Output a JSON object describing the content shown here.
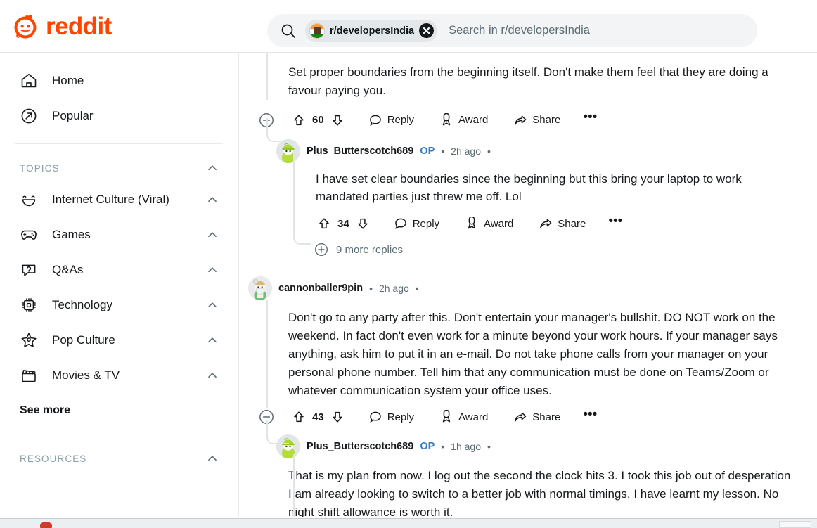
{
  "header": {
    "logo_text": "reddit",
    "logo_icon": "reddit-snoo-icon",
    "brand_color": "#ff4500",
    "search": {
      "icon": "search-icon",
      "chip_label": "r/developersIndia",
      "chip_avatar_icon": "subreddit-avatar-icon",
      "chip_close_icon": "close-icon",
      "placeholder": "Search in r/developersIndia"
    }
  },
  "sidebar": {
    "nav": [
      {
        "label": "Home",
        "icon": "home-icon"
      },
      {
        "label": "Popular",
        "icon": "popular-arrow-icon"
      }
    ],
    "topics_section": {
      "title": "TOPICS",
      "chevron": "chevron-up-icon"
    },
    "topics": [
      {
        "label": "Internet Culture (Viral)",
        "icon": "smiley-face-icon",
        "chevron": "chevron-up-icon"
      },
      {
        "label": "Games",
        "icon": "gamepad-icon",
        "chevron": "chevron-up-icon"
      },
      {
        "label": "Q&As",
        "icon": "question-bubble-icon",
        "chevron": "chevron-up-icon"
      },
      {
        "label": "Technology",
        "icon": "cpu-chip-icon",
        "chevron": "chevron-up-icon"
      },
      {
        "label": "Pop Culture",
        "icon": "star-icon",
        "chevron": "chevron-up-icon"
      },
      {
        "label": "Movies & TV",
        "icon": "clapperboard-icon",
        "chevron": "chevron-up-icon"
      }
    ],
    "see_more": "See more",
    "resources_section": {
      "title": "RESOURCES",
      "chevron": "chevron-up-icon"
    }
  },
  "actions": {
    "reply": "Reply",
    "award": "Award",
    "share": "Share",
    "more": "•••",
    "upvote_icon": "upvote-arrow-icon",
    "downvote_icon": "downvote-arrow-icon",
    "reply_icon": "comment-bubble-icon",
    "award_icon": "award-badge-icon",
    "share_icon": "share-arrow-icon",
    "collapse_icon": "collapse-minus-icon"
  },
  "comments": [
    {
      "id": "c1",
      "text": "Set proper boundaries from the beginning itself. Don't make them feel that they are doing a favour paying you.",
      "score": "60"
    },
    {
      "id": "c1r1",
      "author": "Plus_Butterscotch689",
      "op_badge": "OP",
      "timestamp": "2h ago",
      "separator": "•",
      "avatar_icon": "user-avatar-green-icon",
      "text": "I have set clear boundaries since the beginning but this bring your laptop to work mandated parties just threw me off. Lol",
      "score": "34",
      "more_replies": "9 more replies",
      "more_replies_icon": "expand-plus-icon"
    },
    {
      "id": "c2",
      "author": "cannonballer9pin",
      "timestamp": "2h ago",
      "separator": "•",
      "avatar_icon": "user-avatar-masked-icon",
      "text": "Don't go to any party after this. Don't entertain your manager's bullshit. DO NOT work on the weekend. In fact don't even work for a minute beyond your work hours. If your manager says anything, ask him to put it in an e-mail. Do not take phone calls from your manager on your personal phone number. Tell him that any communication must be done on Teams/Zoom or whatever communication system your office uses.",
      "score": "43"
    },
    {
      "id": "c2r1",
      "author": "Plus_Butterscotch689",
      "op_badge": "OP",
      "timestamp": "1h ago",
      "separator": "•",
      "avatar_icon": "user-avatar-green-icon",
      "text": "That is my plan from now. I log out the second the clock hits 3. I took this job out of desperation I am already looking to switch to a better job with normal timings. I have learnt my lesson. No night shift allowance is worth it."
    }
  ]
}
